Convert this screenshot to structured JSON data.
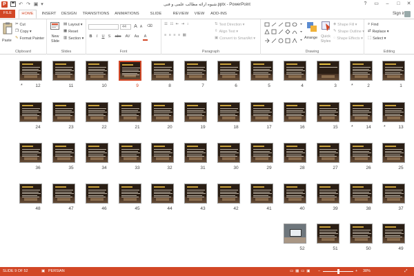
{
  "window": {
    "title": "شیوه ارائه مطالب علمی و فنی.pptx - PowerPoint"
  },
  "quick_access": {
    "logo": "P",
    "save_icon": "save-icon",
    "undo": "↶",
    "redo": "↷",
    "start": "▣",
    "more": "▾"
  },
  "window_controls": {
    "help": "?",
    "options": "▭",
    "minimize": "–",
    "maximize": "□",
    "close": "✕"
  },
  "tabs": [
    "FILE",
    "HOME",
    "INSERT",
    "DESIGN",
    "TRANSITIONS",
    "ANIMATIONS",
    "SLIDE SHOW",
    "REVIEW",
    "VIEW",
    "ADD-INS"
  ],
  "active_tab": "HOME",
  "account": {
    "sign_in": "Sign in"
  },
  "ribbon": {
    "clipboard": {
      "label": "Clipboard",
      "paste": "Paste",
      "cut": "Cut",
      "copy": "Copy",
      "format_painter": "Format Painter"
    },
    "slides": {
      "label": "Slides",
      "new_slide": "New Slide",
      "layout": "Layout",
      "reset": "Reset",
      "section": "Section"
    },
    "font": {
      "label": "Font",
      "font_name": "",
      "font_size": "44",
      "grow": "A",
      "shrink": "A",
      "clear": "⌫",
      "bold": "B",
      "italic": "I",
      "underline": "U",
      "shadow": "S",
      "strike": "abc",
      "spacing": "AV",
      "case": "Aa",
      "color": "A"
    },
    "paragraph": {
      "label": "Paragraph",
      "text_direction": "Text Direction",
      "align_text": "Align Text",
      "convert_smartart": "Convert to SmartArt"
    },
    "drawing": {
      "label": "Drawing",
      "arrange": "Arrange",
      "quick_styles": "Quick Styles",
      "shape_fill": "Shape Fill",
      "shape_outline": "Shape Outline",
      "shape_effects": "Shape Effects"
    },
    "editing": {
      "label": "Editing",
      "find": "Find",
      "replace": "Replace",
      "select": "Select"
    }
  },
  "slides": [
    {
      "n": "1",
      "star": false,
      "kind": "text"
    },
    {
      "n": "2",
      "star": true,
      "kind": "text"
    },
    {
      "n": "3",
      "star": false,
      "kind": "title"
    },
    {
      "n": "4",
      "star": false,
      "kind": "text"
    },
    {
      "n": "5",
      "star": false,
      "kind": "text"
    },
    {
      "n": "6",
      "star": false,
      "kind": "text"
    },
    {
      "n": "7",
      "star": false,
      "kind": "text"
    },
    {
      "n": "8",
      "star": false,
      "kind": "text"
    },
    {
      "n": "9",
      "star": false,
      "kind": "text",
      "selected": true
    },
    {
      "n": "10",
      "star": false,
      "kind": "text"
    },
    {
      "n": "11",
      "star": false,
      "kind": "text"
    },
    {
      "n": "12",
      "star": true,
      "kind": "text"
    },
    {
      "n": "13",
      "star": true,
      "kind": "text"
    },
    {
      "n": "14",
      "star": true,
      "kind": "text"
    },
    {
      "n": "15",
      "star": false,
      "kind": "text"
    },
    {
      "n": "16",
      "star": false,
      "kind": "text"
    },
    {
      "n": "17",
      "star": false,
      "kind": "text"
    },
    {
      "n": "18",
      "star": false,
      "kind": "text"
    },
    {
      "n": "19",
      "star": false,
      "kind": "text"
    },
    {
      "n": "20",
      "star": false,
      "kind": "text"
    },
    {
      "n": "21",
      "star": false,
      "kind": "text"
    },
    {
      "n": "22",
      "star": false,
      "kind": "text"
    },
    {
      "n": "23",
      "star": false,
      "kind": "text"
    },
    {
      "n": "24",
      "star": false,
      "kind": "text"
    },
    {
      "n": "25",
      "star": false,
      "kind": "text"
    },
    {
      "n": "26",
      "star": false,
      "kind": "text"
    },
    {
      "n": "27",
      "star": false,
      "kind": "text"
    },
    {
      "n": "28",
      "star": false,
      "kind": "text"
    },
    {
      "n": "29",
      "star": false,
      "kind": "text"
    },
    {
      "n": "30",
      "star": false,
      "kind": "text"
    },
    {
      "n": "31",
      "star": false,
      "kind": "text"
    },
    {
      "n": "32",
      "star": false,
      "kind": "text"
    },
    {
      "n": "33",
      "star": false,
      "kind": "text"
    },
    {
      "n": "34",
      "star": false,
      "kind": "text"
    },
    {
      "n": "35",
      "star": false,
      "kind": "text"
    },
    {
      "n": "36",
      "star": false,
      "kind": "text"
    },
    {
      "n": "37",
      "star": false,
      "kind": "text"
    },
    {
      "n": "38",
      "star": false,
      "kind": "text"
    },
    {
      "n": "39",
      "star": false,
      "kind": "text"
    },
    {
      "n": "40",
      "star": false,
      "kind": "text"
    },
    {
      "n": "41",
      "star": false,
      "kind": "text"
    },
    {
      "n": "42",
      "star": false,
      "kind": "text"
    },
    {
      "n": "43",
      "star": false,
      "kind": "text"
    },
    {
      "n": "44",
      "star": false,
      "kind": "text"
    },
    {
      "n": "45",
      "star": false,
      "kind": "text"
    },
    {
      "n": "46",
      "star": false,
      "kind": "text"
    },
    {
      "n": "47",
      "star": false,
      "kind": "text"
    },
    {
      "n": "48",
      "star": false,
      "kind": "text"
    },
    {
      "n": "49",
      "star": false,
      "kind": "text"
    },
    {
      "n": "50",
      "star": false,
      "kind": "text"
    },
    {
      "n": "51",
      "star": false,
      "kind": "text"
    },
    {
      "n": "52",
      "star": false,
      "kind": "photo"
    }
  ],
  "status": {
    "slide_info": "SLIDE 9 OF 52",
    "language": "PERSIAN",
    "zoom": "38%",
    "zoom_minus": "–",
    "zoom_plus": "+",
    "zoom_value": 0.38
  },
  "colors": {
    "accent": "#d24726",
    "slide_bg": "#2a1e14",
    "slide_title": "#c9a23c"
  }
}
